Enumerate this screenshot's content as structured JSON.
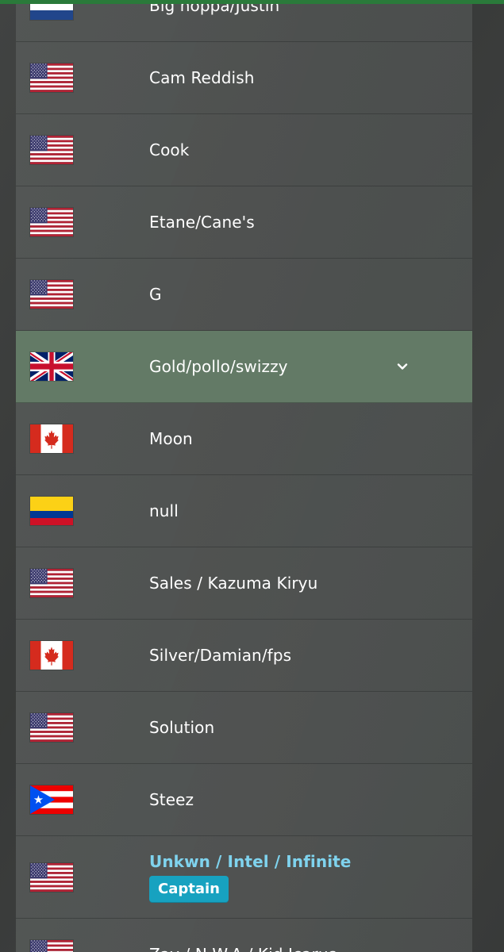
{
  "players": [
    {
      "name": "Big hoppa/Justin",
      "flag": "netherlands-flag-icon"
    },
    {
      "name": "Cam Reddish",
      "flag": "usa-flag-icon"
    },
    {
      "name": "Cook",
      "flag": "usa-flag-icon"
    },
    {
      "name": "Etane/Cane's",
      "flag": "usa-flag-icon"
    },
    {
      "name": "G",
      "flag": "usa-flag-icon"
    },
    {
      "name": "Gold/pollo/swizzy",
      "flag": "uk-flag-icon",
      "expand_icon": "chevron-down-icon"
    },
    {
      "name": "Moon",
      "flag": "canada-flag-icon"
    },
    {
      "name": "null",
      "flag": "colombia-flag-icon"
    },
    {
      "name": "Sales / Kazuma Kiryu",
      "flag": "usa-flag-icon"
    },
    {
      "name": "Silver/Damian/fps",
      "flag": "canada-flag-icon"
    },
    {
      "name": "Solution",
      "flag": "usa-flag-icon"
    },
    {
      "name": "Steez",
      "flag": "puerto-rico-flag-icon"
    },
    {
      "name": "Unkwn / Intel / Infinite",
      "flag": "usa-flag-icon",
      "badge": "Captain"
    },
    {
      "name": "Zay / N.W.A / Kid Icarus",
      "flag": "usa-flag-icon"
    }
  ],
  "colors": {
    "topbar": "#2a7a3a",
    "selected_row": "#637a66",
    "captain_name": "#7fd3ee",
    "captain_badge": "#17a2c0"
  }
}
